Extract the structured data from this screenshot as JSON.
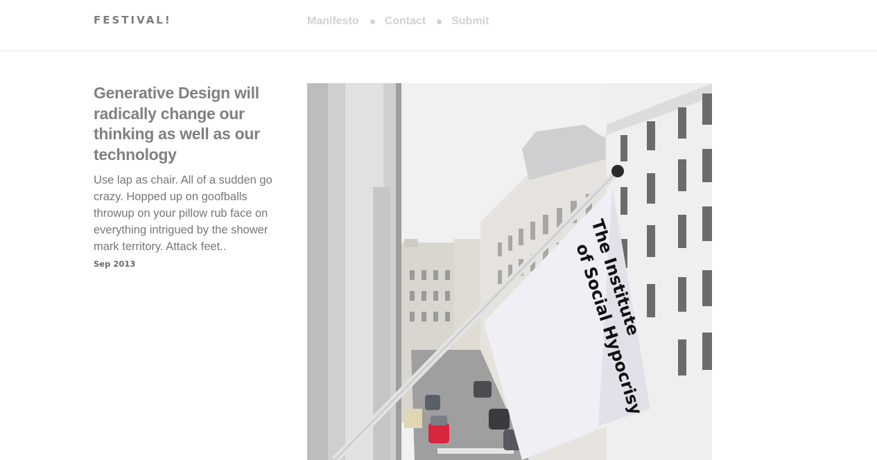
{
  "header": {
    "logo": "FESTIVAL!",
    "nav": [
      {
        "label": "Manifesto"
      },
      {
        "label": "Contact"
      },
      {
        "label": "Submit"
      }
    ]
  },
  "post": {
    "title": "Generative Design will radically change our thinking as well as our technology",
    "excerpt": "Use lap as chair. All of a sudden go crazy. Hopped up on goofballs throwup on your pillow rub face on everything intrigued by the shower mark territory. Attack feet..",
    "date": "Sep 2013"
  },
  "photo": {
    "flag_text_line1": "The Institute",
    "flag_text_line2": "of Social Hypocrisy"
  },
  "colors": {
    "nav_link": "#d2d2d2",
    "title": "#808080",
    "body_text": "#777777"
  }
}
